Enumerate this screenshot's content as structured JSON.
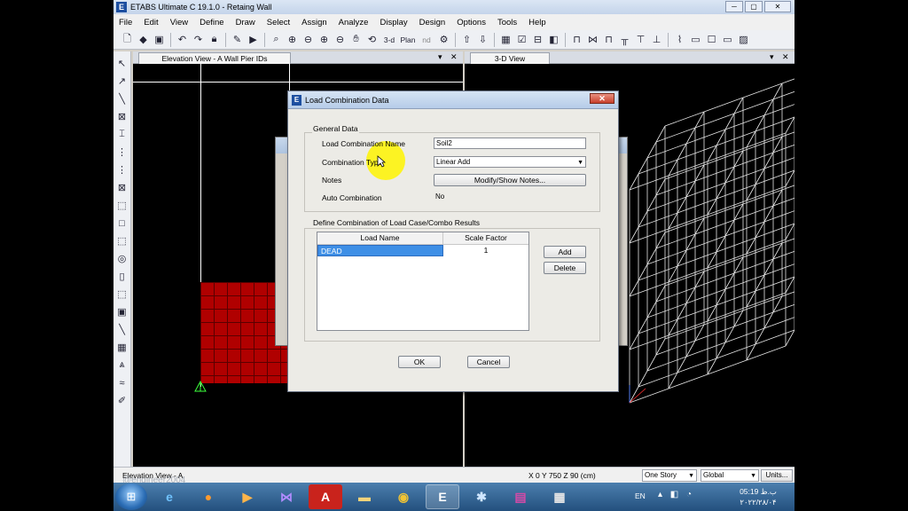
{
  "window": {
    "title": "ETABS Ultimate C 19.1.0 - Retaing Wall",
    "logo": "E",
    "minimize": "─",
    "maximize": "▢",
    "close": "✕"
  },
  "menu": [
    "File",
    "Edit",
    "View",
    "Define",
    "Draw",
    "Select",
    "Assign",
    "Analyze",
    "Display",
    "Design",
    "Options",
    "Tools",
    "Help"
  ],
  "toolbar": {
    "icons": [
      "new-file",
      "open-folder",
      "save",
      "undo",
      "redo",
      "lock",
      "pencil",
      "run",
      "zoom-window",
      "zoom-in",
      "zoom-out",
      "zoom-prev",
      "zoom-next",
      "pan",
      "rotate-3d",
      "3d-view",
      "plan-view",
      "elev-view",
      "object-shrink",
      "refresh",
      "move-up",
      "move-down",
      "grid-options",
      "checkbox",
      "display-options",
      "object-fill",
      "section-cut",
      "beam",
      "column",
      "frame",
      "brace",
      "wall",
      "slab",
      "opening",
      "restraint"
    ],
    "view_3d_label": "3-d",
    "plan_label": "Plan",
    "elev_label": "nd"
  },
  "left_toolbar": [
    "pointer",
    "reshape",
    "line",
    "rectangle",
    "node",
    "frame-draw",
    "brace-draw",
    "area-draw",
    "rect-area",
    "polygon-area",
    "quad-area",
    "wall-draw",
    "opening",
    "link",
    "grid-tool",
    "tendon",
    "spring",
    "dimension"
  ],
  "panels": {
    "elevation": {
      "tab": "Elevation View - A  Wall Pier IDs",
      "dropdown": "▾",
      "close": "✕"
    },
    "view3d": {
      "tab": "3-D View",
      "dropdown": "▾",
      "close": "✕"
    }
  },
  "dialog": {
    "title": "Load Combination Data",
    "close": "✕",
    "general_group": "General Data",
    "name_label": "Load Combination Name",
    "name_value": "Soil2",
    "type_label": "Combination Type",
    "type_value": "Linear Add",
    "notes_label": "Notes",
    "notes_button": "Modify/Show Notes...",
    "auto_label": "Auto Combination",
    "auto_value": "No",
    "define_group": "Define Combination of Load Case/Combo Results",
    "table": {
      "columns": [
        "Load Name",
        "Scale Factor"
      ],
      "rows": [
        {
          "load_name": "DEAD",
          "scale_factor": "1"
        }
      ]
    },
    "add_button": "Add",
    "delete_button": "Delete",
    "ok_button": "OK",
    "cancel_button": "Cancel"
  },
  "status": {
    "left": "Elevation View - A",
    "coords": "X 0  Y 750  Z 90 (cm)",
    "story": "One Story",
    "coord_system": "Global",
    "units": "Units..."
  },
  "watermark": "@engineer2004",
  "taskbar": {
    "apps": [
      "ie",
      "firefox",
      "media-player",
      "visual-studio",
      "acrobat",
      "file-explorer",
      "chrome",
      "etabs",
      "paint",
      "winrar",
      "calculator"
    ],
    "lang": "EN",
    "time": "05:19 ب.ظ",
    "date": "۲۰۲۲/۲۸/۰۴"
  },
  "colors": {
    "wall_fill": "#b00000",
    "selection": "#3e8fe6",
    "cursor_highlight": "#fff400",
    "taskbar": "#2f5f90"
  }
}
